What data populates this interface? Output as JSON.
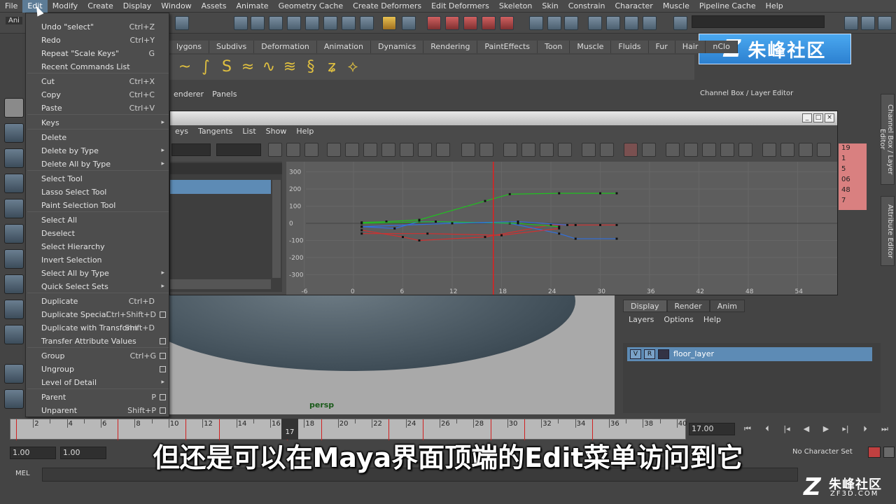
{
  "menubar": [
    "File",
    "Edit",
    "Modify",
    "Create",
    "Display",
    "Window",
    "Assets",
    "Animate",
    "Geometry Cache",
    "Create Deformers",
    "Edit Deformers",
    "Skeleton",
    "Skin",
    "Constrain",
    "Character",
    "Muscle",
    "Pipeline Cache",
    "Help"
  ],
  "mode_label": "Ani",
  "shelf_tabs": [
    "lygons",
    "Subdivs",
    "Deformation",
    "Animation",
    "Dynamics",
    "Rendering",
    "PaintEffects",
    "Toon",
    "Muscle",
    "Fluids",
    "Fur",
    "Hair",
    "nClo"
  ],
  "logo_text": "朱峰社区",
  "viewport_menu": [
    "enderer",
    "Panels"
  ],
  "viewport_label": "persp",
  "edit_menu": [
    {
      "label": "Undo \"select\"",
      "shortcut": "Ctrl+Z"
    },
    {
      "label": "Redo",
      "shortcut": "Ctrl+Y"
    },
    {
      "label": "Repeat \"Scale Keys\"",
      "shortcut": "G"
    },
    {
      "label": "Recent Commands List",
      "shortcut": ""
    },
    {
      "label": "Cut",
      "shortcut": "Ctrl+X"
    },
    {
      "label": "Copy",
      "shortcut": "Ctrl+C"
    },
    {
      "label": "Paste",
      "shortcut": "Ctrl+V"
    },
    {
      "label": "Keys",
      "shortcut": ""
    },
    {
      "label": "Delete",
      "shortcut": ""
    },
    {
      "label": "Delete by Type",
      "shortcut": ""
    },
    {
      "label": "Delete All by Type",
      "shortcut": ""
    },
    {
      "label": "Select Tool",
      "shortcut": ""
    },
    {
      "label": "Lasso Select Tool",
      "shortcut": ""
    },
    {
      "label": "Paint Selection Tool",
      "shortcut": ""
    },
    {
      "label": "Select All",
      "shortcut": ""
    },
    {
      "label": "Deselect",
      "shortcut": ""
    },
    {
      "label": "Select Hierarchy",
      "shortcut": ""
    },
    {
      "label": "Invert Selection",
      "shortcut": ""
    },
    {
      "label": "Select All by Type",
      "shortcut": ""
    },
    {
      "label": "Quick Select Sets",
      "shortcut": ""
    },
    {
      "label": "Duplicate",
      "shortcut": "Ctrl+D"
    },
    {
      "label": "Duplicate Special",
      "shortcut": "Ctrl+Shift+D"
    },
    {
      "label": "Duplicate with Transform",
      "shortcut": "Shift+D"
    },
    {
      "label": "Transfer Attribute Values",
      "shortcut": ""
    },
    {
      "label": "Group",
      "shortcut": "Ctrl+G"
    },
    {
      "label": "Ungroup",
      "shortcut": ""
    },
    {
      "label": "Level of Detail",
      "shortcut": ""
    },
    {
      "label": "Parent",
      "shortcut": "P"
    },
    {
      "label": "Unparent",
      "shortcut": "Shift+P"
    }
  ],
  "graph_editor": {
    "menu": [
      "eys",
      "Tangents",
      "List",
      "Show",
      "Help"
    ],
    "title_buttons": [
      "_",
      "□",
      "×"
    ],
    "y_ticks": [
      "300",
      "200",
      "100",
      "0",
      "-100",
      "-200",
      "-300"
    ],
    "x_ticks": [
      "-6",
      "0",
      "6",
      "12",
      "18",
      "24",
      "30",
      "36",
      "42",
      "48",
      "54"
    ]
  },
  "channel_box": {
    "title": "Channel Box / Layer Editor",
    "values": [
      "19",
      "1",
      "5",
      "06",
      "48",
      "7"
    ]
  },
  "side_tabs": [
    "Channel Box / Layer Editor",
    "Attribute Editor"
  ],
  "layer_editor": {
    "tabs": [
      "Display",
      "Render",
      "Anim"
    ],
    "menu": [
      "Layers",
      "Options",
      "Help"
    ],
    "layer": {
      "v": "V",
      "r": "R",
      "name": "floor_layer"
    }
  },
  "timeline": {
    "labels": [
      "2",
      "4",
      "6",
      "8",
      "10",
      "12",
      "14",
      "16",
      "18",
      "20",
      "22",
      "24",
      "26",
      "28",
      "30",
      "32",
      "34",
      "36",
      "38",
      "40"
    ],
    "current_frame": "17",
    "frame_field": "17.00"
  },
  "range": {
    "start": "1.00",
    "start2": "1.00"
  },
  "character_set": "No Character Set",
  "mel_label": "MEL",
  "subtitle": "但还是可以在Maya界面顶端的Edit菜单访问到它",
  "watermark": {
    "text": "朱峰社区",
    "url": "ZF3D.COM"
  }
}
